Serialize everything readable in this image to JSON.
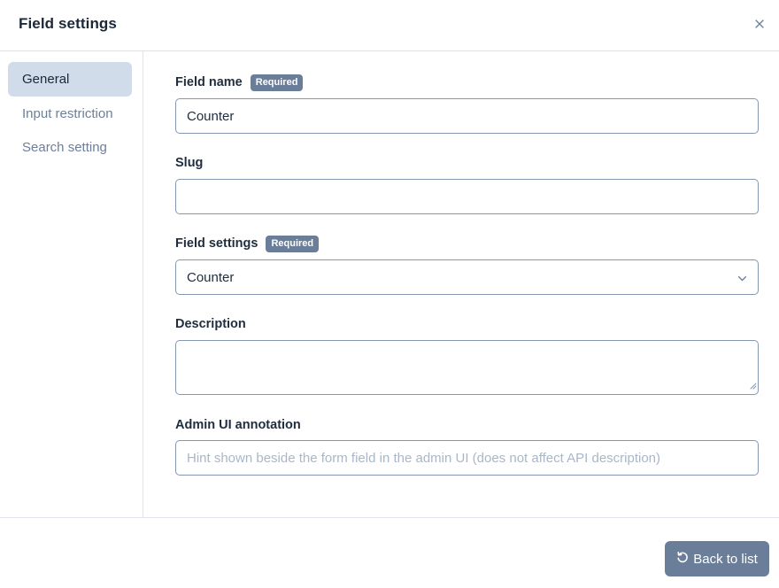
{
  "header": {
    "title": "Field settings",
    "close_icon": "close-icon"
  },
  "sidebar": {
    "items": [
      {
        "label": "General",
        "active": true
      },
      {
        "label": "Input restriction",
        "active": false
      },
      {
        "label": "Search setting",
        "active": false
      }
    ]
  },
  "form": {
    "required_badge": "Required",
    "field_name": {
      "label": "Field name",
      "value": "Counter",
      "required": true
    },
    "slug": {
      "label": "Slug",
      "value": ""
    },
    "field_settings": {
      "label": "Field settings",
      "value": "Counter",
      "required": true,
      "icon": "chevron-down-icon"
    },
    "description": {
      "label": "Description",
      "value": ""
    },
    "admin_ui_annotation": {
      "label": "Admin UI annotation",
      "placeholder": "Hint shown beside the form field in the admin UI (does not affect API description)"
    }
  },
  "footer": {
    "back_label": "Back to list",
    "back_icon": "rotate-ccw-icon"
  },
  "colors": {
    "accent": "#6b7e99",
    "active_nav_bg": "#d1dcea",
    "border": "#8497b0"
  }
}
